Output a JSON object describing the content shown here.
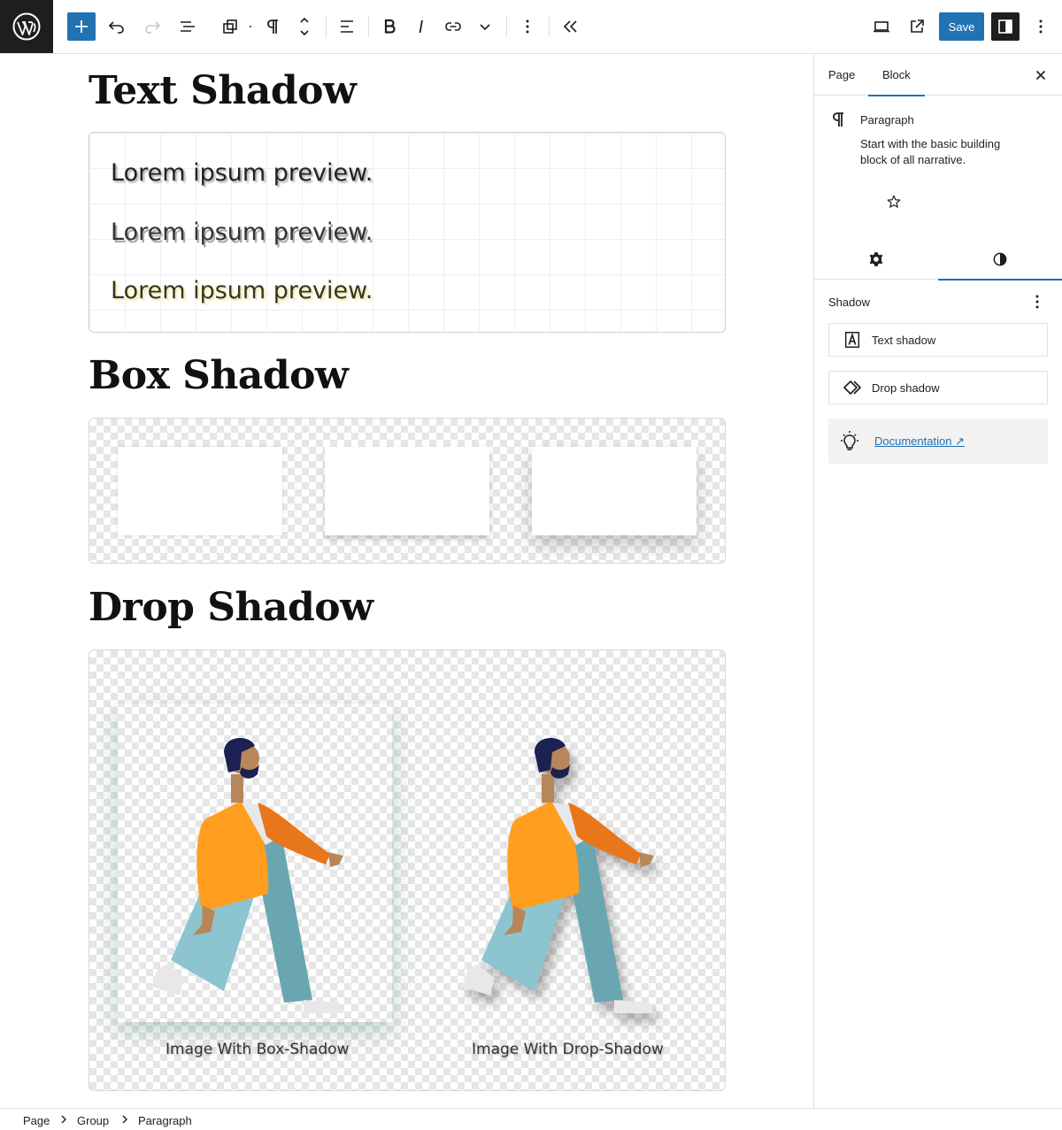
{
  "toolbar": {
    "save_label": "Save",
    "colors": {
      "accent": "#2271b1",
      "dark": "#1e1e1e"
    }
  },
  "canvas": {
    "text_shadow_heading": "Text Shadow",
    "lorem_lines": [
      "Lorem ipsum preview.",
      "Lorem ipsum preview.",
      "Lorem ipsum preview."
    ],
    "box_shadow_heading": "Box Shadow",
    "drop_shadow_heading": "Drop Shadow",
    "captions": [
      "Image With Box-Shadow",
      "Image With Drop-Shadow"
    ]
  },
  "sidebar": {
    "tabs": [
      "Page",
      "Block"
    ],
    "block_title": "Paragraph",
    "block_description": "Start with the basic building block of all narrative.",
    "panel_title": "Shadow",
    "shadow_options": [
      "Text shadow",
      "Drop shadow"
    ],
    "documentation_link": "Documentation ↗"
  },
  "breadcrumb": [
    "Page",
    "Group",
    "Paragraph"
  ]
}
